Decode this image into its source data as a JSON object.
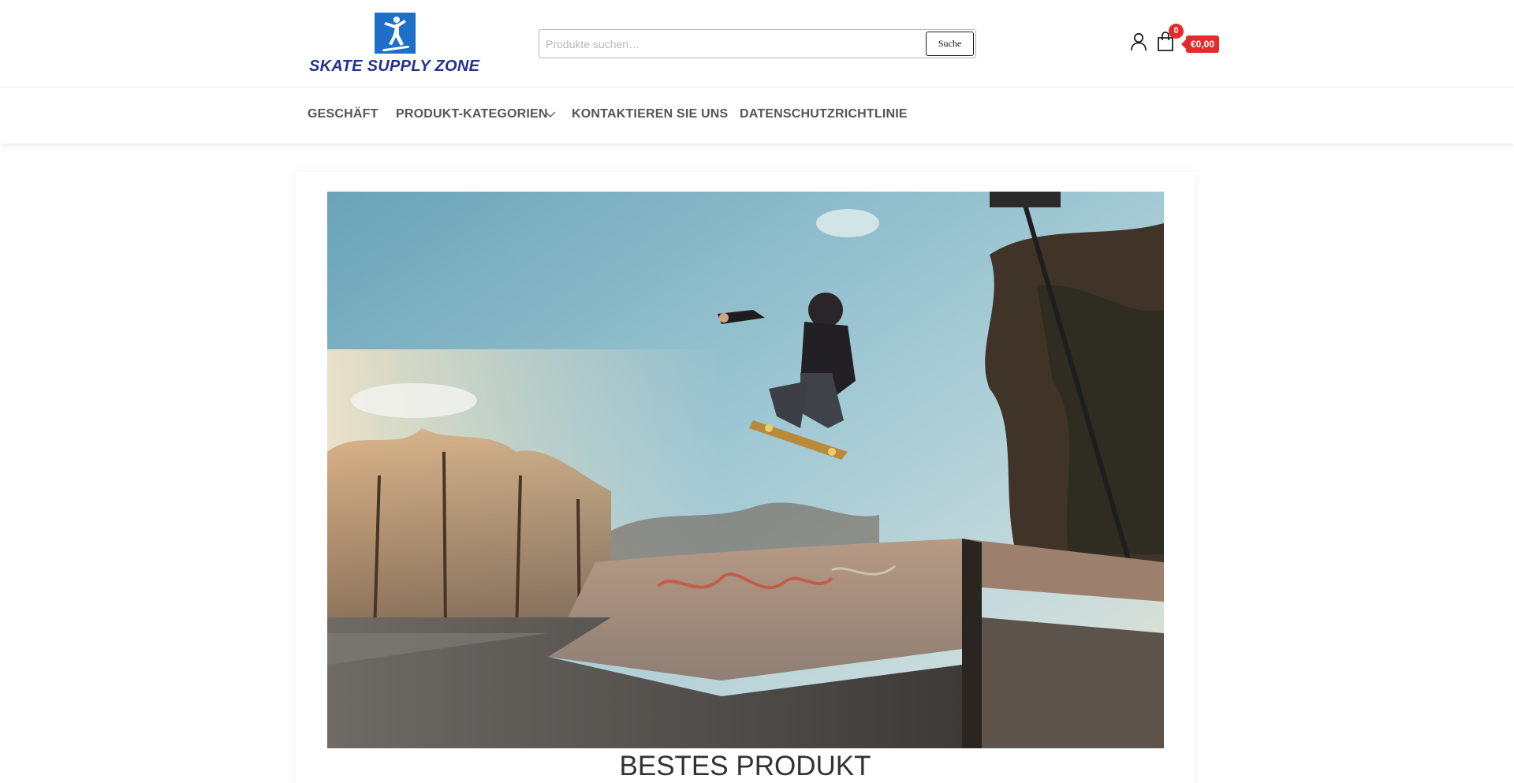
{
  "site": {
    "logo_text": "SKATE SUPPLY ZONE"
  },
  "search": {
    "placeholder": "Produkte suchen…",
    "value": "",
    "button_label": "Suche"
  },
  "header": {
    "user_icon": "user-icon",
    "cart_icon": "shopping-bag-icon",
    "cart_count": "0",
    "cart_total": "€0,00"
  },
  "nav": {
    "items": [
      {
        "label": "GESCHÄFT"
      },
      {
        "label": "PRODUKT-KATEGORIEN",
        "has_dropdown": true
      },
      {
        "label": "KONTAKTIEREN SIE UNS"
      },
      {
        "label": "DATENSCHUTZRICHTLINIE"
      }
    ]
  },
  "main": {
    "hero_image": "skateboarder-jumping-at-skatepark",
    "title": "BESTES PRODUKT"
  },
  "colors": {
    "accent": "#e32b2b",
    "logo_blue": "#23308f",
    "logo_mark": "#1e6fc8",
    "nav_text": "#555555"
  }
}
